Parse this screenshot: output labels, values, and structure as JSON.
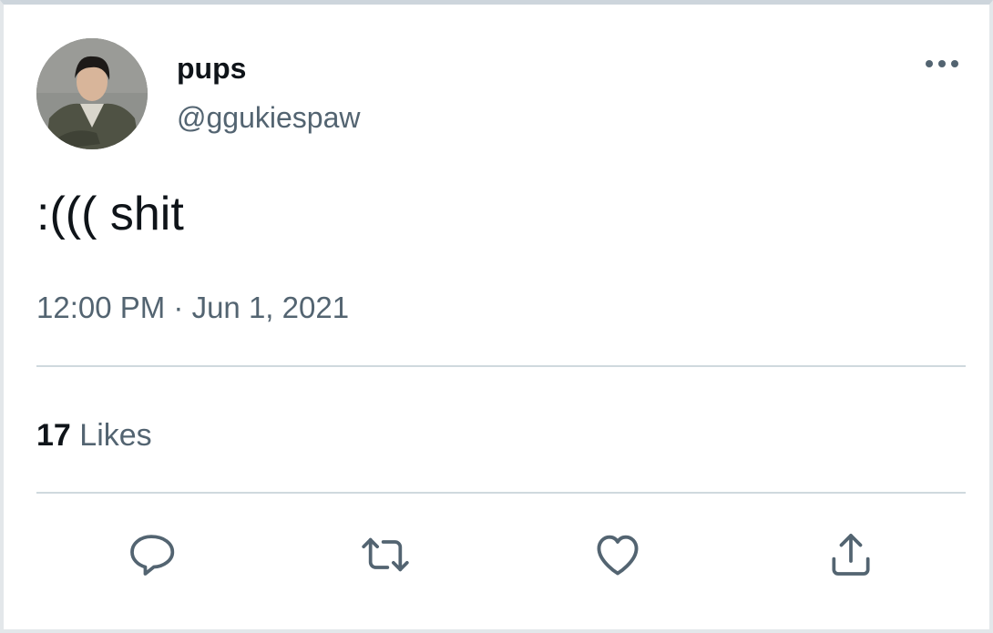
{
  "author": {
    "display_name": "pups",
    "handle": "@ggukiespaw",
    "avatar_icon": "profile-photo"
  },
  "tweet": {
    "text": ":((( shit",
    "timestamp": "12:00 PM · Jun 1, 2021"
  },
  "stats": {
    "likes_count": "17",
    "likes_label": "Likes"
  },
  "actions": {
    "reply_icon": "reply-icon",
    "retweet_icon": "retweet-icon",
    "like_icon": "heart-icon",
    "share_icon": "share-icon",
    "more_icon": "more-horizontal-icon"
  },
  "colors": {
    "primary_text": "#0f1419",
    "secondary_text": "#536471",
    "divider": "#cfd9de"
  }
}
